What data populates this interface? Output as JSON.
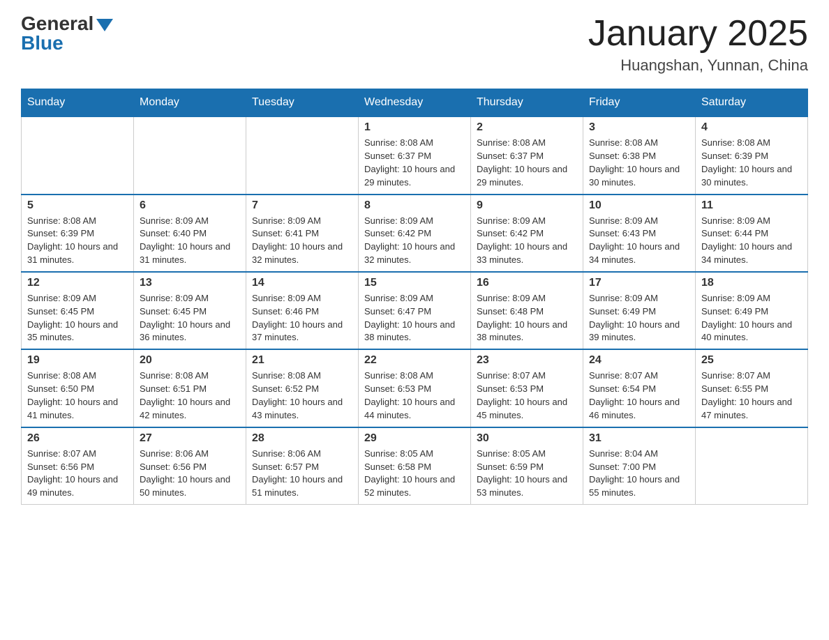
{
  "header": {
    "logo_general": "General",
    "logo_blue": "Blue",
    "title": "January 2025",
    "subtitle": "Huangshan, Yunnan, China"
  },
  "days_of_week": [
    "Sunday",
    "Monday",
    "Tuesday",
    "Wednesday",
    "Thursday",
    "Friday",
    "Saturday"
  ],
  "weeks": [
    {
      "days": [
        {
          "num": "",
          "info": ""
        },
        {
          "num": "",
          "info": ""
        },
        {
          "num": "",
          "info": ""
        },
        {
          "num": "1",
          "info": "Sunrise: 8:08 AM\nSunset: 6:37 PM\nDaylight: 10 hours and 29 minutes."
        },
        {
          "num": "2",
          "info": "Sunrise: 8:08 AM\nSunset: 6:37 PM\nDaylight: 10 hours and 29 minutes."
        },
        {
          "num": "3",
          "info": "Sunrise: 8:08 AM\nSunset: 6:38 PM\nDaylight: 10 hours and 30 minutes."
        },
        {
          "num": "4",
          "info": "Sunrise: 8:08 AM\nSunset: 6:39 PM\nDaylight: 10 hours and 30 minutes."
        }
      ]
    },
    {
      "days": [
        {
          "num": "5",
          "info": "Sunrise: 8:08 AM\nSunset: 6:39 PM\nDaylight: 10 hours and 31 minutes."
        },
        {
          "num": "6",
          "info": "Sunrise: 8:09 AM\nSunset: 6:40 PM\nDaylight: 10 hours and 31 minutes."
        },
        {
          "num": "7",
          "info": "Sunrise: 8:09 AM\nSunset: 6:41 PM\nDaylight: 10 hours and 32 minutes."
        },
        {
          "num": "8",
          "info": "Sunrise: 8:09 AM\nSunset: 6:42 PM\nDaylight: 10 hours and 32 minutes."
        },
        {
          "num": "9",
          "info": "Sunrise: 8:09 AM\nSunset: 6:42 PM\nDaylight: 10 hours and 33 minutes."
        },
        {
          "num": "10",
          "info": "Sunrise: 8:09 AM\nSunset: 6:43 PM\nDaylight: 10 hours and 34 minutes."
        },
        {
          "num": "11",
          "info": "Sunrise: 8:09 AM\nSunset: 6:44 PM\nDaylight: 10 hours and 34 minutes."
        }
      ]
    },
    {
      "days": [
        {
          "num": "12",
          "info": "Sunrise: 8:09 AM\nSunset: 6:45 PM\nDaylight: 10 hours and 35 minutes."
        },
        {
          "num": "13",
          "info": "Sunrise: 8:09 AM\nSunset: 6:45 PM\nDaylight: 10 hours and 36 minutes."
        },
        {
          "num": "14",
          "info": "Sunrise: 8:09 AM\nSunset: 6:46 PM\nDaylight: 10 hours and 37 minutes."
        },
        {
          "num": "15",
          "info": "Sunrise: 8:09 AM\nSunset: 6:47 PM\nDaylight: 10 hours and 38 minutes."
        },
        {
          "num": "16",
          "info": "Sunrise: 8:09 AM\nSunset: 6:48 PM\nDaylight: 10 hours and 38 minutes."
        },
        {
          "num": "17",
          "info": "Sunrise: 8:09 AM\nSunset: 6:49 PM\nDaylight: 10 hours and 39 minutes."
        },
        {
          "num": "18",
          "info": "Sunrise: 8:09 AM\nSunset: 6:49 PM\nDaylight: 10 hours and 40 minutes."
        }
      ]
    },
    {
      "days": [
        {
          "num": "19",
          "info": "Sunrise: 8:08 AM\nSunset: 6:50 PM\nDaylight: 10 hours and 41 minutes."
        },
        {
          "num": "20",
          "info": "Sunrise: 8:08 AM\nSunset: 6:51 PM\nDaylight: 10 hours and 42 minutes."
        },
        {
          "num": "21",
          "info": "Sunrise: 8:08 AM\nSunset: 6:52 PM\nDaylight: 10 hours and 43 minutes."
        },
        {
          "num": "22",
          "info": "Sunrise: 8:08 AM\nSunset: 6:53 PM\nDaylight: 10 hours and 44 minutes."
        },
        {
          "num": "23",
          "info": "Sunrise: 8:07 AM\nSunset: 6:53 PM\nDaylight: 10 hours and 45 minutes."
        },
        {
          "num": "24",
          "info": "Sunrise: 8:07 AM\nSunset: 6:54 PM\nDaylight: 10 hours and 46 minutes."
        },
        {
          "num": "25",
          "info": "Sunrise: 8:07 AM\nSunset: 6:55 PM\nDaylight: 10 hours and 47 minutes."
        }
      ]
    },
    {
      "days": [
        {
          "num": "26",
          "info": "Sunrise: 8:07 AM\nSunset: 6:56 PM\nDaylight: 10 hours and 49 minutes."
        },
        {
          "num": "27",
          "info": "Sunrise: 8:06 AM\nSunset: 6:56 PM\nDaylight: 10 hours and 50 minutes."
        },
        {
          "num": "28",
          "info": "Sunrise: 8:06 AM\nSunset: 6:57 PM\nDaylight: 10 hours and 51 minutes."
        },
        {
          "num": "29",
          "info": "Sunrise: 8:05 AM\nSunset: 6:58 PM\nDaylight: 10 hours and 52 minutes."
        },
        {
          "num": "30",
          "info": "Sunrise: 8:05 AM\nSunset: 6:59 PM\nDaylight: 10 hours and 53 minutes."
        },
        {
          "num": "31",
          "info": "Sunrise: 8:04 AM\nSunset: 7:00 PM\nDaylight: 10 hours and 55 minutes."
        },
        {
          "num": "",
          "info": ""
        }
      ]
    }
  ]
}
